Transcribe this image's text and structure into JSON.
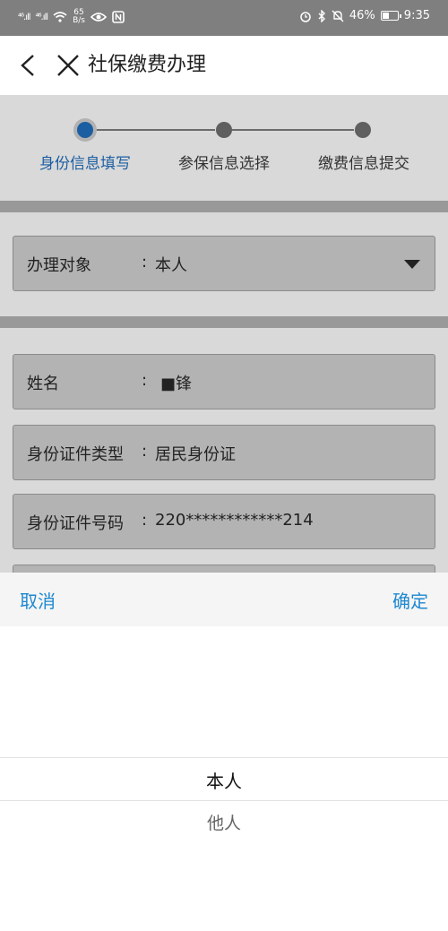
{
  "status_bar": {
    "signal1": "⁴⁶.ıll",
    "signal2": "⁴⁶.ıll",
    "speed_value": "65",
    "speed_unit": "B/s",
    "battery": "46%",
    "time": "9:35",
    "battery_level": 0.46
  },
  "header": {
    "title": "社保缴费办理"
  },
  "steps": [
    {
      "label": "身份信息填写",
      "active": true
    },
    {
      "label": "参保信息选择",
      "active": false
    },
    {
      "label": "缴费信息提交",
      "active": false
    }
  ],
  "form": {
    "target": {
      "label": "办理对象",
      "colon": ":",
      "value": "本人"
    },
    "name": {
      "label": "姓名",
      "colon": ":",
      "value": "■锋"
    },
    "id_type": {
      "label": "身份证件类型",
      "colon": ":",
      "value": "居民身份证"
    },
    "id_number": {
      "label": "身份证件号码",
      "colon": ":",
      "value": "220************214"
    }
  },
  "picker": {
    "cancel": "取消",
    "confirm": "确定",
    "options": [
      "本人",
      "他人"
    ],
    "selected": "本人"
  },
  "colors": {
    "accent": "#1e88d0",
    "step_active": "#1c5ea2"
  }
}
